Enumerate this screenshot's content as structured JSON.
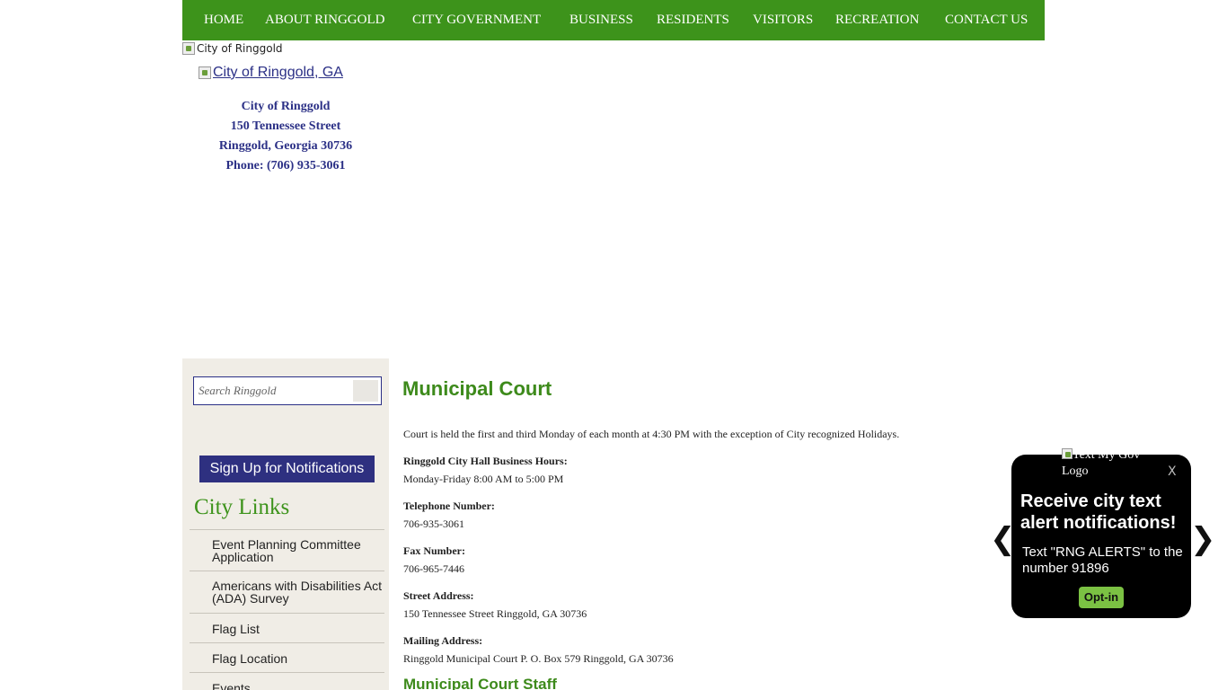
{
  "nav": {
    "items": [
      {
        "label": "HOME"
      },
      {
        "label": "ABOUT RINGGOLD"
      },
      {
        "label": "CITY GOVERNMENT"
      },
      {
        "label": "BUSINESS"
      },
      {
        "label": "RESIDENTS"
      },
      {
        "label": "VISITORS"
      },
      {
        "label": "RECREATION"
      },
      {
        "label": "CONTACT US"
      }
    ]
  },
  "header": {
    "banner_alt": "City of Ringgold",
    "logo_alt": "City of Ringgold, GA",
    "address": {
      "name": "City of Ringgold",
      "street": "150 Tennessee Street",
      "city": "Ringgold, Georgia 30736",
      "phone": "Phone: (706) 935-3061"
    }
  },
  "sidebar": {
    "search_placeholder": "Search Ringgold",
    "signup_label": "Sign Up for Notifications",
    "city_links_title": "City Links",
    "links": [
      {
        "label": "Event Planning Committee Application"
      },
      {
        "label": "Americans with Disabilities Act (ADA) Survey"
      },
      {
        "label": "Flag List"
      },
      {
        "label": "Flag Location"
      },
      {
        "label": "Events"
      }
    ]
  },
  "main": {
    "title": "Municipal Court",
    "intro": "Court is held the first and third Monday of each month at 4:30 PM with the exception of City recognized Holidays.",
    "hours_label": "Ringgold City Hall Business Hours:",
    "hours_value": "Monday-Friday 8:00 AM to 5:00 PM",
    "phone_label": "Telephone Number:",
    "phone_value": "706-935-3061",
    "fax_label": "Fax Number:",
    "fax_value": "706-965-7446",
    "street_label": "Street Address:",
    "street_value": "150 Tennessee Street Ringgold, GA 30736",
    "mailing_label": "Mailing Address:",
    "mailing_value": "Ringgold Municipal Court P. O. Box 579 Ringgold, GA 30736",
    "staff_title": "Municipal Court Staff"
  },
  "popup": {
    "logo_alt": "Text My Gov Logo",
    "close_label": "X",
    "heading": "Receive city text alert notifications!",
    "body": "Text \"RNG ALERTS\" to the number 91896",
    "optin_label": "Opt-in",
    "prev_arrow": "❮",
    "next_arrow": "❯"
  },
  "colors": {
    "nav_green": "#3d931b",
    "title_green": "#3d8a1b",
    "navy": "#2b3086",
    "sidebar_bg": "#f0ede6",
    "optin_green": "#7bc143"
  }
}
